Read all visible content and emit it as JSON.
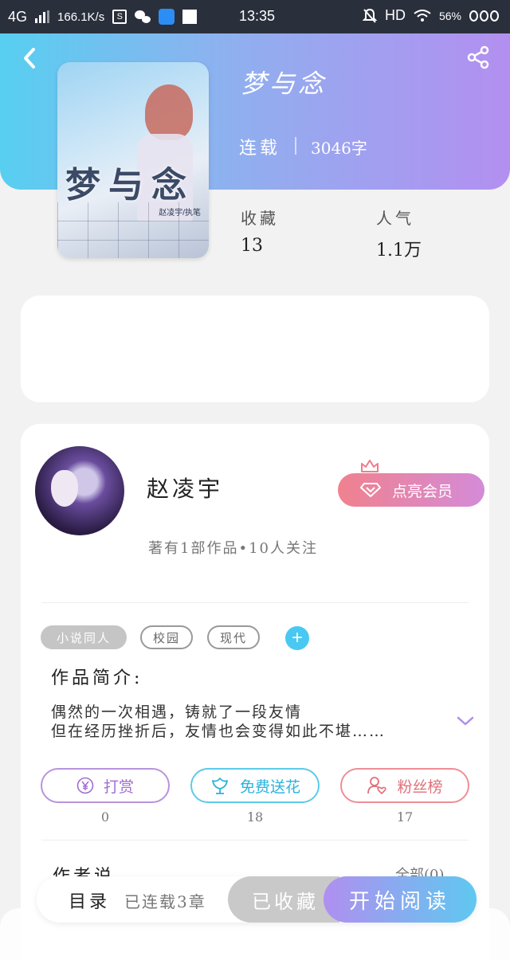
{
  "status_bar": {
    "network": "4G",
    "speed": "166.1K/s",
    "time": "13:35",
    "hd": "HD",
    "battery": "56%"
  },
  "header": {
    "back_icon": "chevron-left-icon",
    "share_icon": "share-icon"
  },
  "book": {
    "title": "梦与念",
    "cover_title": "梦与念",
    "cover_author": "赵凌宇/执笔",
    "status": "连载",
    "words": "3046字",
    "favorites_label": "收藏",
    "favorites_value": "13",
    "popularity_label": "人气",
    "popularity_value": "1.1万"
  },
  "author": {
    "name": "赵凌宇",
    "meta": "著有1部作品•10人关注",
    "vip_label": "点亮会员"
  },
  "tags": [
    "小说同人",
    "校园",
    "现代"
  ],
  "intro": {
    "title": "作品简介:",
    "lines": [
      "偶然的一次相遇，铸就了一段友情",
      "但在经历挫折后，友情也会变得如此不堪……"
    ]
  },
  "actions": [
    {
      "label": "打赏",
      "count": "0",
      "icon": "yen-coin-icon"
    },
    {
      "label": "免费送花",
      "count": "18",
      "icon": "flower-icon"
    },
    {
      "label": "粉丝榜",
      "count": "17",
      "icon": "fan-heart-icon"
    }
  ],
  "author_says": {
    "title": "作者说",
    "more": "全部(0)"
  },
  "bottom_bar": {
    "toc_label": "目录",
    "toc_status": "已连载3章",
    "collected_label": "已收藏",
    "read_label": "开始阅读"
  },
  "colors": {
    "gradient_start": "#57cff0",
    "gradient_end": "#b38ff0",
    "vip_start": "#f0818e",
    "vip_end": "#d48bd8",
    "accent_blue": "#49c8f2"
  }
}
